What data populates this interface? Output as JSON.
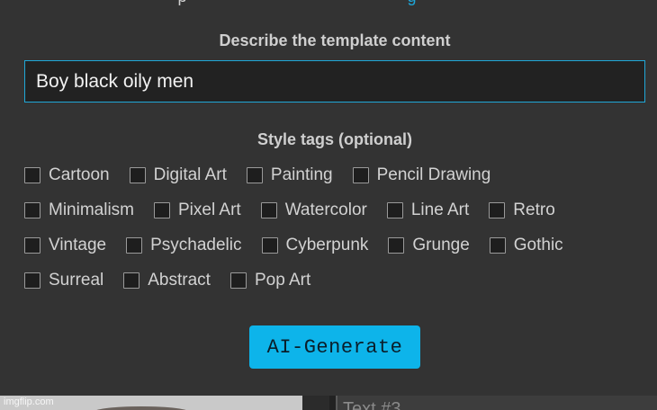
{
  "header_cut": {
    "text": "p",
    "link_text": "g"
  },
  "description": {
    "title": "Describe the template content",
    "value": "Boy black oily men"
  },
  "style_tags": {
    "title": "Style tags (optional)",
    "rows": [
      [
        "Cartoon",
        "Digital Art",
        "Painting",
        "Pencil Drawing"
      ],
      [
        "Minimalism",
        "Pixel Art",
        "Watercolor",
        "Line Art",
        "Retro"
      ],
      [
        "Vintage",
        "Psychadelic",
        "Cyberpunk",
        "Grunge",
        "Gothic"
      ],
      [
        "Surreal",
        "Abstract",
        "Pop Art"
      ]
    ]
  },
  "generate_button": {
    "label": "AI-Generate"
  },
  "bottom": {
    "text_box_placeholder": "Text #3",
    "watermark": "imgflip.com"
  },
  "colors": {
    "background": "#333333",
    "accent": "#0db4ea",
    "input_border": "#20a8d8"
  }
}
